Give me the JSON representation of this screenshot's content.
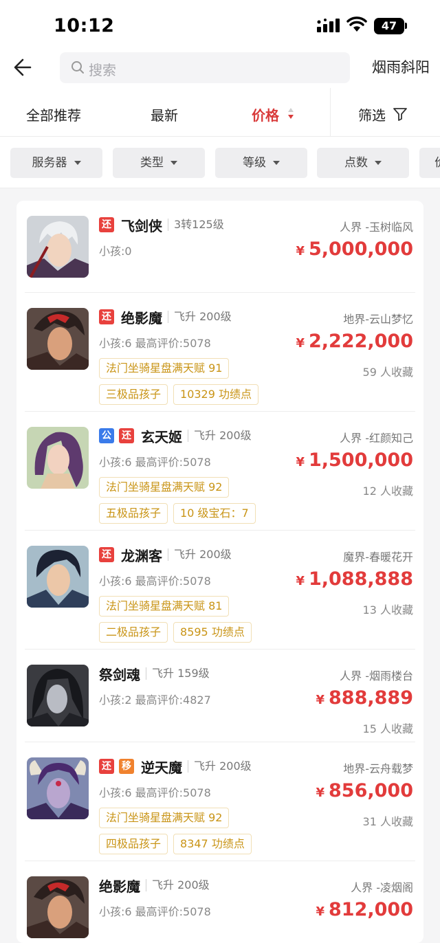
{
  "status": {
    "time": "10:12",
    "battery": "47"
  },
  "header": {
    "search_placeholder": "搜索",
    "server_name": "烟雨斜阳"
  },
  "sort": {
    "recommend": "全部推荐",
    "latest": "最新",
    "price": "价格",
    "filter": "筛选"
  },
  "filters": [
    "服务器",
    "类型",
    "等级",
    "点数",
    "价"
  ],
  "colors": {
    "price_red": "#e23b3b",
    "tag_gold": "#c99416",
    "badge_huan": "#e8413d",
    "badge_gong": "#3a7bea",
    "badge_yi": "#f0822e"
  },
  "listings": [
    {
      "badges": [
        "还"
      ],
      "name": "飞剑侠",
      "level": "3转125级",
      "sub": "小孩:0",
      "server": "人界 -玉树临风",
      "price": "5,000,000",
      "favorites": "",
      "tags": []
    },
    {
      "badges": [
        "还"
      ],
      "name": "绝影魔",
      "level": "飞升 200级",
      "sub": "小孩:6 最高评价:5078",
      "server": "地界-云山梦忆",
      "price": "2,222,000",
      "favorites": "59 人收藏",
      "tags": [
        "法门坐骑星盘满天赋 91",
        "三极品孩子",
        "10329 功绩点"
      ]
    },
    {
      "badges": [
        "公",
        "还"
      ],
      "name": "玄天姬",
      "level": "飞升 200级",
      "sub": "小孩:6 最高评价:5078",
      "server": "人界 -红颜知己",
      "price": "1,500,000",
      "favorites": "12 人收藏",
      "tags": [
        "法门坐骑星盘满天赋 92",
        "五极品孩子",
        "10 级宝石：7"
      ]
    },
    {
      "badges": [
        "还"
      ],
      "name": "龙渊客",
      "level": "飞升 200级",
      "sub": "小孩:6 最高评价:5078",
      "server": "魔界-春暖花开",
      "price": "1,088,888",
      "favorites": "13 人收藏",
      "tags": [
        "法门坐骑星盘满天赋 81",
        "二极品孩子",
        "8595 功绩点"
      ]
    },
    {
      "badges": [],
      "name": "祭剑魂",
      "level": "飞升 159级",
      "sub": "小孩:2 最高评价:4827",
      "server": "人界 -烟雨楼台",
      "price": "888,889",
      "favorites": "15 人收藏",
      "tags": []
    },
    {
      "badges": [
        "还",
        "移"
      ],
      "name": "逆天魔",
      "level": "飞升 200级",
      "sub": "小孩:6 最高评价:5078",
      "server": "地界-云舟载梦",
      "price": "856,000",
      "favorites": "31 人收藏",
      "tags": [
        "法门坐骑星盘满天赋 92",
        "四极品孩子",
        "8347 功绩点"
      ]
    },
    {
      "badges": [],
      "name": "绝影魔",
      "level": "飞升 200级",
      "sub": "小孩:6 最高评价:5078",
      "server": "人界 -凌烟阁",
      "price": "812,000",
      "favorites": "",
      "tags": []
    }
  ]
}
